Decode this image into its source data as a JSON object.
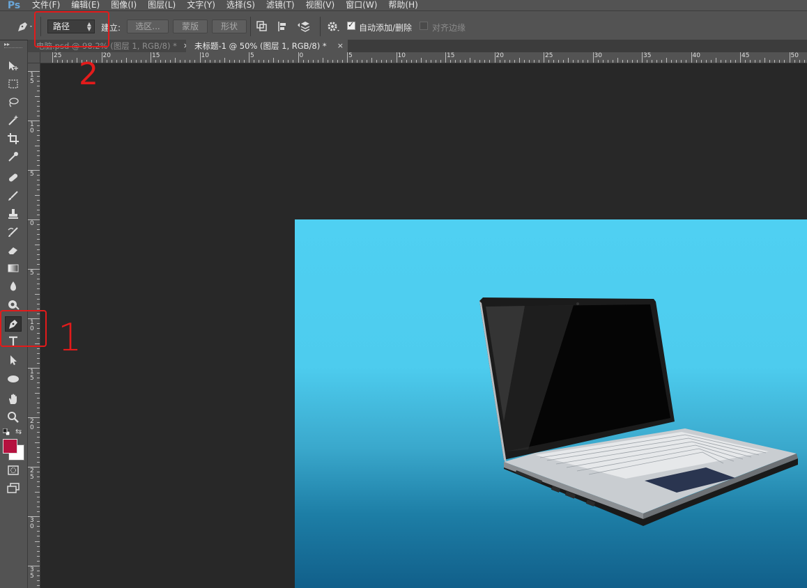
{
  "app": {
    "logo": "Ps"
  },
  "menu": [
    "文件(F)",
    "编辑(E)",
    "图像(I)",
    "图层(L)",
    "文字(Y)",
    "选择(S)",
    "滤镜(T)",
    "视图(V)",
    "窗口(W)",
    "帮助(H)"
  ],
  "options": {
    "tool_mode": "路径",
    "make_label": "建立:",
    "selection_button": "选区...",
    "mask_button": "蒙版",
    "shape_button": "形状",
    "auto_add_delete": "自动添加/删除",
    "auto_add_delete_checked": true,
    "align_edges": "对齐边缘",
    "align_edges_checked": false
  },
  "tabs": [
    {
      "label": "电脑.psd @ 98.2% (图层 1, RGB/8) *",
      "active": false
    },
    {
      "label": "未标题-1 @ 50% (图层 1, RGB/8) *",
      "active": true
    }
  ],
  "tab_close": "×",
  "ruler_top": [
    "25",
    "20",
    "15",
    "10",
    "5",
    "0",
    "5",
    "10",
    "15",
    "20",
    "25",
    "30",
    "35",
    "40",
    "45",
    "50"
  ],
  "ruler_left": [
    "15",
    "10",
    "5",
    "0",
    "5",
    "10",
    "15",
    "20",
    "25",
    "30",
    "35"
  ],
  "tools": [
    "move-icon",
    "marquee-icon",
    "lasso-icon",
    "magic-wand-icon",
    "crop-icon",
    "eyedropper-icon",
    "healing-brush-icon",
    "brush-icon",
    "clone-stamp-icon",
    "history-brush-icon",
    "eraser-icon",
    "gradient-icon",
    "blur-icon",
    "dodge-icon",
    "pen-icon",
    "type-icon",
    "path-selection-icon",
    "ellipse-icon",
    "hand-icon",
    "zoom-icon"
  ],
  "colors": {
    "foreground": "#b5123f",
    "background": "#ffffff",
    "annotation": "#e31b1b"
  },
  "annotations": {
    "label_1": "1",
    "label_2": "2"
  }
}
